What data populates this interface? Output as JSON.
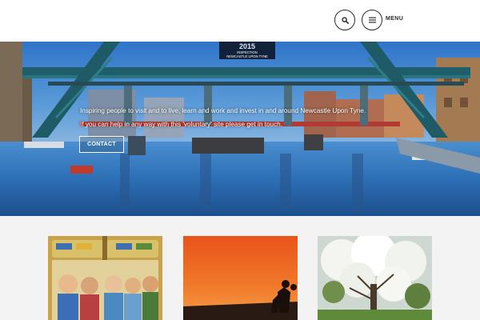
{
  "header": {
    "search_icon": "search-icon",
    "menu_icon": "hamburger-icon",
    "menu_label": "MENU"
  },
  "hero": {
    "line1": "Inspiring people to visit and to live, learn and work and invest in and around Newcastle Upon Tyne.",
    "line2": "If you can help in any way with this 'voluntary' site please get in touch.",
    "contact_label": "CONTACT",
    "sign_year": "2015",
    "sign_line1": "INSPECTION",
    "sign_line2": "NEWCASTLE UPON TYNE"
  },
  "posts": [
    {
      "image": "mural-painting"
    },
    {
      "image": "sunset-silhouette"
    },
    {
      "image": "blossom-tree"
    }
  ],
  "colors": {
    "accent": "#2b2b2b",
    "content_bg": "#f3f3f3"
  }
}
